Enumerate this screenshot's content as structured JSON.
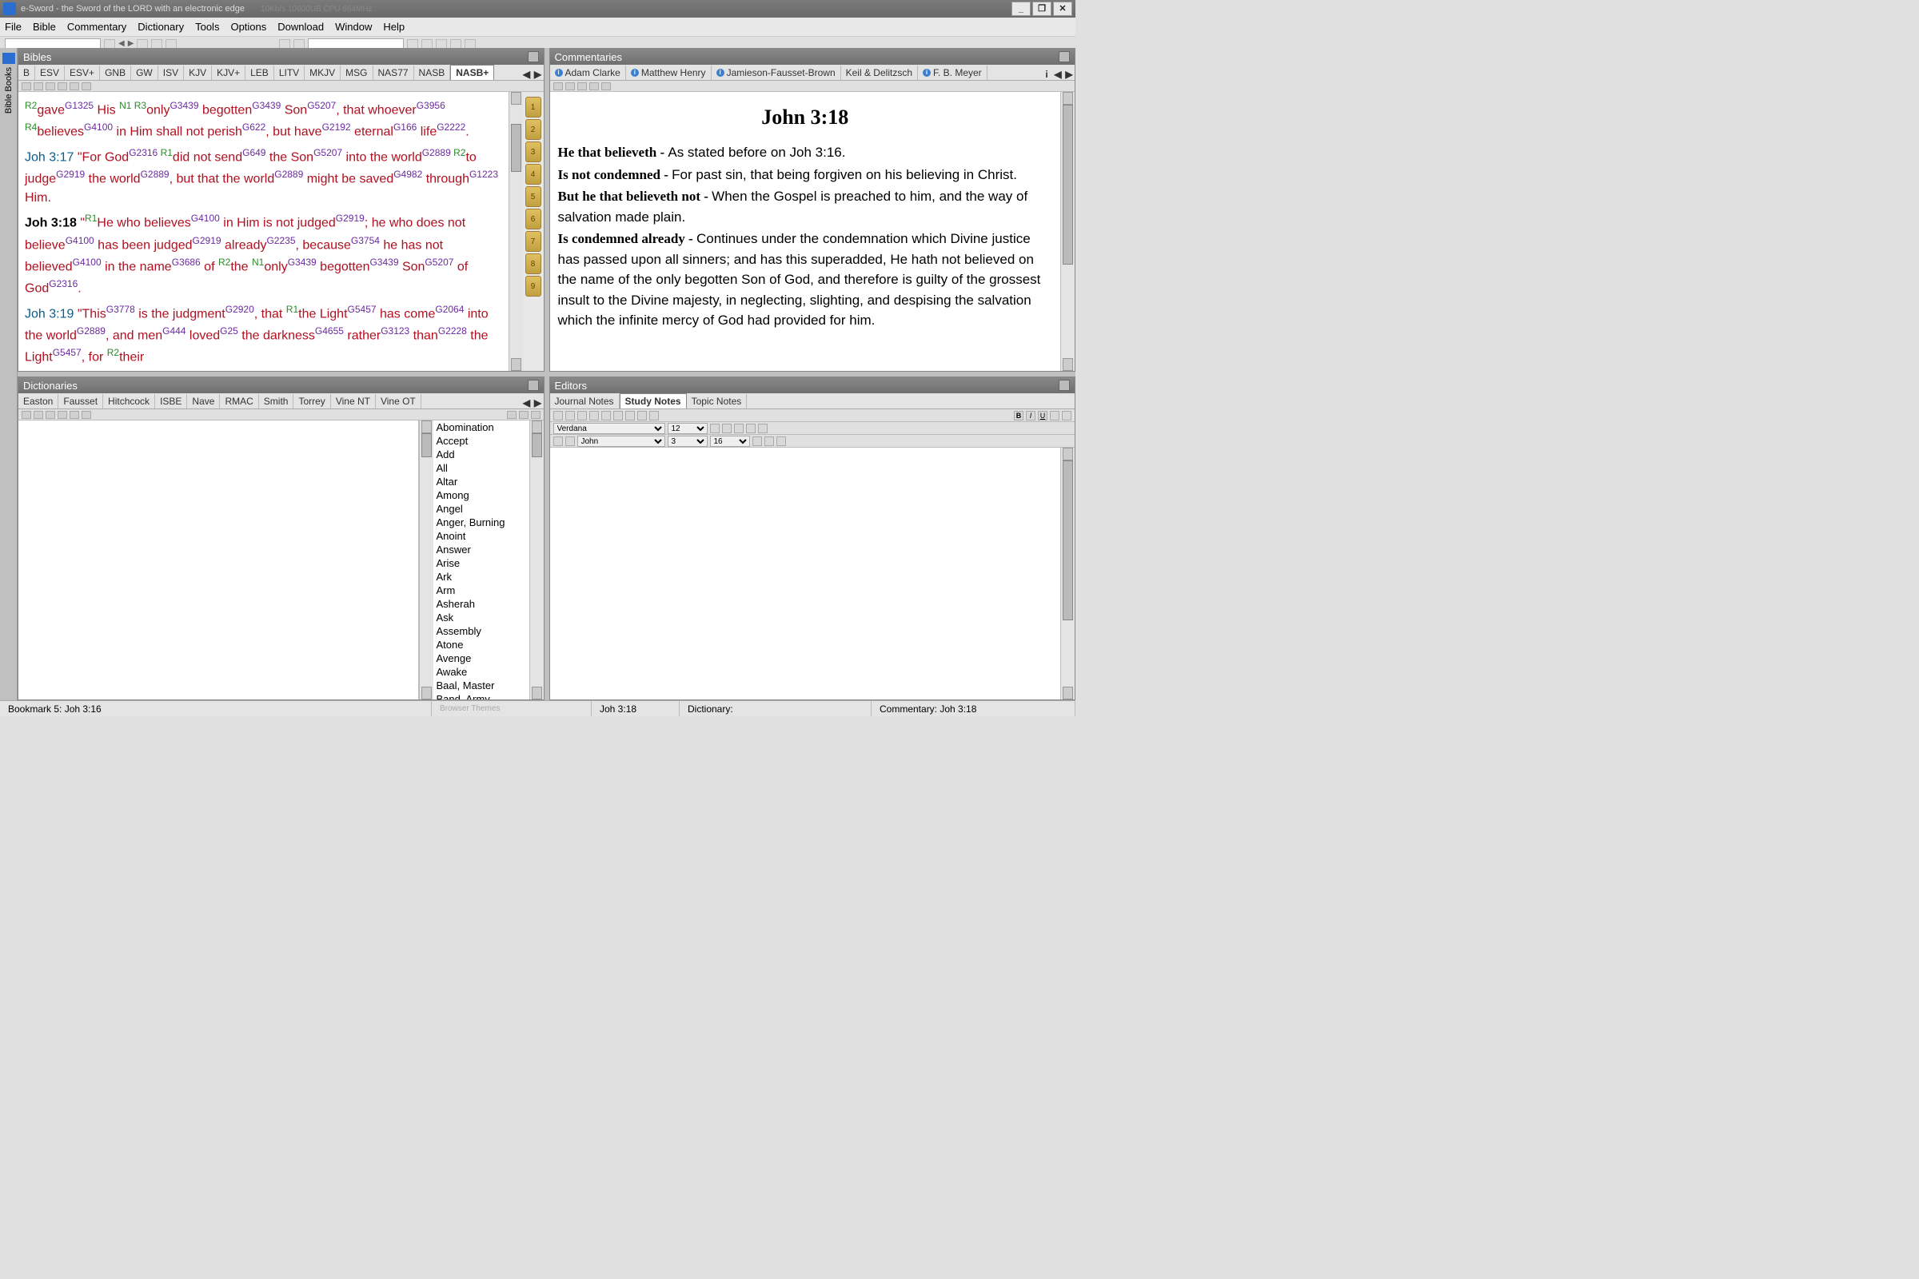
{
  "app": {
    "title": "e-Sword - the Sword of the LORD with an electronic edge",
    "taskbar_hint": "10Kb/s  10600UB  CPU  664MHz"
  },
  "menu": [
    "File",
    "Bible",
    "Commentary",
    "Dictionary",
    "Tools",
    "Options",
    "Download",
    "Window",
    "Help"
  ],
  "panels": {
    "bibles": "Bibles",
    "commentaries": "Commentaries",
    "dictionaries": "Dictionaries",
    "editors": "Editors"
  },
  "leftbar": "Bible Books",
  "bible_tabs": [
    "B",
    "ESV",
    "ESV+",
    "GNB",
    "GW",
    "ISV",
    "KJV",
    "KJV+",
    "LEB",
    "LITV",
    "MKJV",
    "MSG",
    "NAS77",
    "NASB",
    "NASB+"
  ],
  "bible_active_tab": "NASB+",
  "bible_verses": {
    "v16_part": {
      "tokens": [
        {
          "t": "rn",
          "v": "R2"
        },
        {
          "t": "w",
          "v": "gave"
        },
        {
          "t": "sn",
          "v": "G1325"
        },
        {
          "t": "w",
          "v": " His "
        },
        {
          "t": "rn",
          "v": "N1 "
        },
        {
          "t": "rn",
          "v": "R3"
        },
        {
          "t": "w",
          "v": "only"
        },
        {
          "t": "sn",
          "v": "G3439"
        },
        {
          "t": "w",
          "v": " begotten"
        },
        {
          "t": "sn",
          "v": "G3439"
        },
        {
          "t": "w",
          "v": " Son"
        },
        {
          "t": "sn",
          "v": "G5207"
        },
        {
          "t": "w",
          "v": ", that whoever"
        },
        {
          "t": "sn",
          "v": "G3956"
        },
        {
          "t": "rn",
          "v": " R4"
        },
        {
          "t": "w",
          "v": "believes"
        },
        {
          "t": "sn",
          "v": "G4100"
        },
        {
          "t": "w",
          "v": " in Him shall not perish"
        },
        {
          "t": "sn",
          "v": "G622"
        },
        {
          "t": "w",
          "v": ", but have"
        },
        {
          "t": "sn",
          "v": "G2192"
        },
        {
          "t": "w",
          "v": " eternal"
        },
        {
          "t": "sn",
          "v": "G166"
        },
        {
          "t": "w",
          "v": " life"
        },
        {
          "t": "sn",
          "v": "G2222"
        },
        {
          "t": "w",
          "v": "."
        }
      ]
    },
    "v17": {
      "ref": "Joh 3:17",
      "tokens": [
        {
          "t": "w",
          "v": "  \"For God"
        },
        {
          "t": "sn",
          "v": "G2316"
        },
        {
          "t": "rn",
          "v": " R1"
        },
        {
          "t": "w",
          "v": "did not send"
        },
        {
          "t": "sn",
          "v": "G649"
        },
        {
          "t": "w",
          "v": " the Son"
        },
        {
          "t": "sn",
          "v": "G5207"
        },
        {
          "t": "w",
          "v": " into the world"
        },
        {
          "t": "sn",
          "v": "G2889"
        },
        {
          "t": "rn",
          "v": " R2"
        },
        {
          "t": "w",
          "v": "to judge"
        },
        {
          "t": "sn",
          "v": "G2919"
        },
        {
          "t": "w",
          "v": " the world"
        },
        {
          "t": "sn",
          "v": "G2889"
        },
        {
          "t": "w",
          "v": ", but that the world"
        },
        {
          "t": "sn",
          "v": "G2889"
        },
        {
          "t": "w",
          "v": " might be saved"
        },
        {
          "t": "sn",
          "v": "G4982"
        },
        {
          "t": "w",
          "v": " through"
        },
        {
          "t": "sn",
          "v": "G1223"
        },
        {
          "t": "w",
          "v": " Him."
        }
      ]
    },
    "v18": {
      "ref": "Joh 3:18",
      "tokens": [
        {
          "t": "w",
          "v": "  \""
        },
        {
          "t": "rn",
          "v": "R1"
        },
        {
          "t": "w",
          "v": "He who believes"
        },
        {
          "t": "sn",
          "v": "G4100"
        },
        {
          "t": "w",
          "v": " in Him is not judged"
        },
        {
          "t": "sn",
          "v": "G2919"
        },
        {
          "t": "w",
          "v": "; he who does not believe"
        },
        {
          "t": "sn",
          "v": "G4100"
        },
        {
          "t": "w",
          "v": " has been judged"
        },
        {
          "t": "sn",
          "v": "G2919"
        },
        {
          "t": "w",
          "v": " already"
        },
        {
          "t": "sn",
          "v": "G2235"
        },
        {
          "t": "w",
          "v": ", because"
        },
        {
          "t": "sn",
          "v": "G3754"
        },
        {
          "t": "w",
          "v": " he has not believed"
        },
        {
          "t": "sn",
          "v": "G4100"
        },
        {
          "t": "w",
          "v": " in the name"
        },
        {
          "t": "sn",
          "v": "G3686"
        },
        {
          "t": "w",
          "v": " of "
        },
        {
          "t": "rn",
          "v": "R2"
        },
        {
          "t": "w",
          "v": "the "
        },
        {
          "t": "rn",
          "v": "N1"
        },
        {
          "t": "w",
          "v": "only"
        },
        {
          "t": "sn",
          "v": "G3439"
        },
        {
          "t": "w",
          "v": " begotten"
        },
        {
          "t": "sn",
          "v": "G3439"
        },
        {
          "t": "w",
          "v": " Son"
        },
        {
          "t": "sn",
          "v": "G5207"
        },
        {
          "t": "w",
          "v": " of God"
        },
        {
          "t": "sn",
          "v": "G2316"
        },
        {
          "t": "w",
          "v": "."
        }
      ]
    },
    "v19": {
      "ref": "Joh 3:19",
      "tokens": [
        {
          "t": "w",
          "v": "  \"This"
        },
        {
          "t": "sn",
          "v": "G3778"
        },
        {
          "t": "w",
          "v": " is the judgment"
        },
        {
          "t": "sn",
          "v": "G2920"
        },
        {
          "t": "w",
          "v": ", that "
        },
        {
          "t": "rn",
          "v": "R1"
        },
        {
          "t": "w",
          "v": "the Light"
        },
        {
          "t": "sn",
          "v": "G5457"
        },
        {
          "t": "w",
          "v": " has come"
        },
        {
          "t": "sn",
          "v": "G2064"
        },
        {
          "t": "w",
          "v": " into the world"
        },
        {
          "t": "sn",
          "v": "G2889"
        },
        {
          "t": "w",
          "v": ", and men"
        },
        {
          "t": "sn",
          "v": "G444"
        },
        {
          "t": "w",
          "v": " loved"
        },
        {
          "t": "sn",
          "v": "G25"
        },
        {
          "t": "w",
          "v": " the darkness"
        },
        {
          "t": "sn",
          "v": "G4655"
        },
        {
          "t": "w",
          "v": " rather"
        },
        {
          "t": "sn",
          "v": "G3123"
        },
        {
          "t": "w",
          "v": " than"
        },
        {
          "t": "sn",
          "v": "G2228"
        },
        {
          "t": "w",
          "v": " the Light"
        },
        {
          "t": "sn",
          "v": "G5457"
        },
        {
          "t": "w",
          "v": ", for "
        },
        {
          "t": "rn",
          "v": "R2"
        },
        {
          "t": "w",
          "v": "their"
        }
      ]
    }
  },
  "verse_markers": [
    "1",
    "2",
    "3",
    "4",
    "5",
    "6",
    "7",
    "8",
    "9"
  ],
  "commentary_tabs": [
    "Adam Clarke",
    "Matthew Henry",
    "Jamieson-Fausset-Brown",
    "Keil & Delitzsch",
    "F. B. Meyer"
  ],
  "commentary": {
    "title": "John 3:18",
    "entries": [
      {
        "head": "He that believeth - ",
        "body": "As stated before on Joh 3:16."
      },
      {
        "head": "Is not condemned - ",
        "body": "For past sin, that being forgiven on his believing in Christ."
      },
      {
        "head": "But he that believeth not - ",
        "body": "When the Gospel is preached to him, and the way of salvation made plain."
      },
      {
        "head": "Is condemned already - ",
        "body": "Continues under the condemnation which Divine justice has passed upon all sinners; and has this superadded, He hath not believed on the name of the only begotten Son of God, and therefore is guilty of the grossest insult to the Divine majesty, in neglecting, slighting, and despising the salvation which the infinite mercy of God had provided for him."
      }
    ]
  },
  "dict_tabs": [
    "Easton",
    "Fausset",
    "Hitchcock",
    "ISBE",
    "Nave",
    "RMAC",
    "Smith",
    "Torrey",
    "Vine NT",
    "Vine OT"
  ],
  "dict_words": [
    "Abomination",
    "Accept",
    "Add",
    "All",
    "Altar",
    "Among",
    "Angel",
    "Anger, Burning",
    "Anoint",
    "Answer",
    "Arise",
    "Ark",
    "Arm",
    "Asherah",
    "Ask",
    "Assembly",
    "Atone",
    "Avenge",
    "Awake",
    "Baal, Master",
    "Band, Army"
  ],
  "editor_tabs": [
    "Journal Notes",
    "Study Notes",
    "Topic Notes"
  ],
  "editor": {
    "font": "Verdana",
    "size": "12",
    "book": "John",
    "chapter": "3",
    "verse": "16"
  },
  "status": {
    "bookmark": "Bookmark 5: Joh 3:16",
    "center": "Browser Themes",
    "verse": "Joh 3:18",
    "dictionary": "Dictionary:",
    "commentary": "Commentary: Joh 3:18"
  }
}
